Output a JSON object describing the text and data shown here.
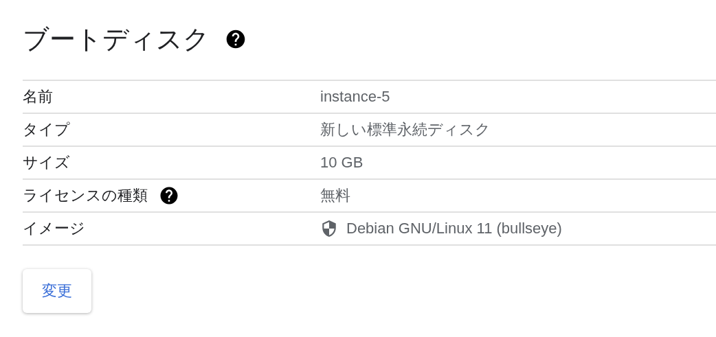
{
  "section": {
    "title": "ブートディスク"
  },
  "rows": [
    {
      "kind": "text",
      "label": "名前",
      "value": "instance-5"
    },
    {
      "kind": "text",
      "label": "タイプ",
      "value": "新しい標準永続ディスク"
    },
    {
      "kind": "text",
      "label": "サイズ",
      "value": "10 GB"
    },
    {
      "kind": "help",
      "label": "ライセンスの種類",
      "value": "無料"
    },
    {
      "kind": "image",
      "label": "イメージ",
      "value": "Debian GNU/Linux 11 (bullseye)"
    }
  ],
  "buttons": [
    {
      "label": "変更"
    }
  ]
}
